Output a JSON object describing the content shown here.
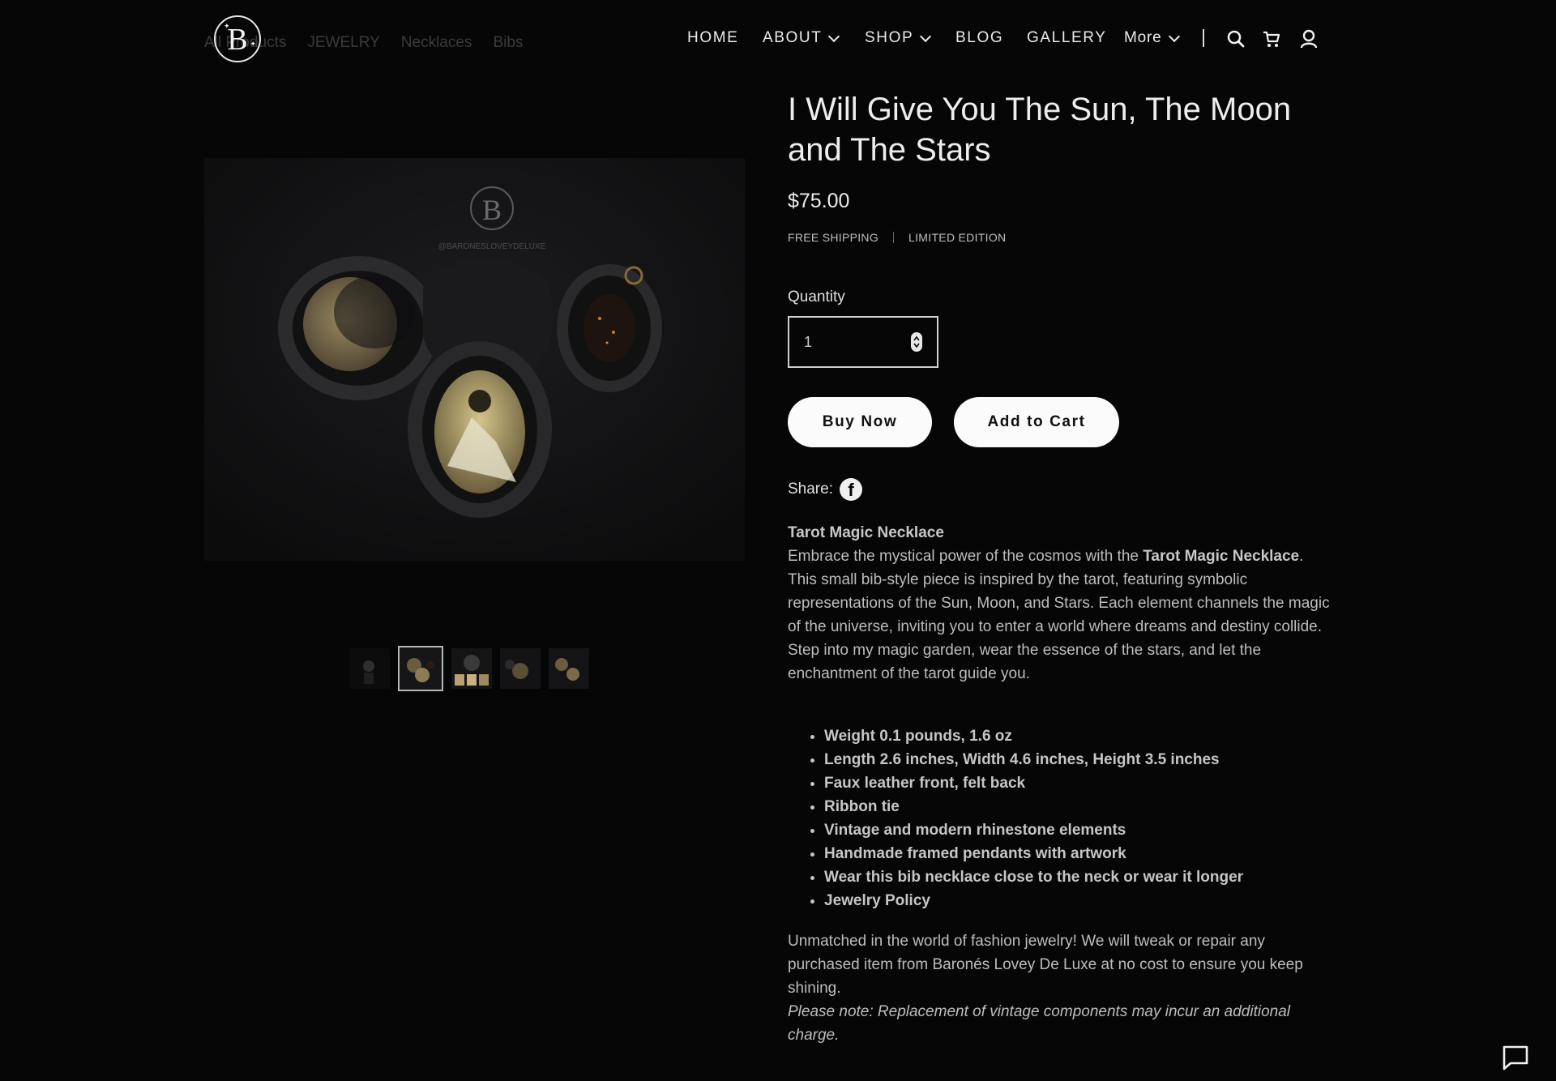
{
  "header": {
    "logo_letter": "B",
    "breadcrumbs": [
      "All Products",
      "JEWELRY",
      "Necklaces",
      "Bibs"
    ],
    "nav": [
      "HOME",
      "ABOUT",
      "SHOP",
      "BLOG",
      "GALLERY",
      "More"
    ]
  },
  "product": {
    "title": "I Will Give You The Sun, The Moon and The Stars",
    "price": "$75.00",
    "tags": [
      "FREE SHIPPING",
      "LIMITED EDITION"
    ],
    "image_watermark": "@BARONESLOVEYDELUXE",
    "quantity_label": "Quantity",
    "quantity_value": "1",
    "buy_now": "Buy Now",
    "add_to_cart": "Add to Cart",
    "share_label": "Share:"
  },
  "thumbnails": {
    "count": 5,
    "selected_index": 1
  },
  "description": {
    "heading": "Tarot Magic Necklace",
    "intro_before": "Embrace the mystical power of the cosmos with the ",
    "intro_bold": "Tarot Magic Necklace",
    "intro_after": ". This small bib-style piece is inspired by the tarot, featuring symbolic representations of the Sun, Moon, and Stars. Each element channels the magic of the universe, inviting you to enter a world where dreams and destiny collide. Step into my magic garden, wear the essence of the stars, and let the enchantment of the tarot guide you."
  },
  "specs": [
    "Weight 0.1 pounds, 1.6 oz",
    "Length 2.6 inches, Width 4.6 inches, Height 3.5 inches",
    "Faux leather front, felt back",
    "Ribbon tie",
    "Vintage and modern rhinestone elements",
    "Handmade framed pendants with artwork",
    "Wear this bib necklace close to the neck or wear it longer",
    "Jewelry Policy"
  ],
  "policy": {
    "text": "Unmatched in the world of fashion jewelry! We will tweak or repair any purchased item from Baronés Lovey De Luxe at no cost to ensure you keep shining.",
    "note": "Please note: Replacement of vintage components may incur an additional charge."
  },
  "colors": {
    "background": "#060607",
    "button": "#fbfbfb",
    "text": "#bdbdbd"
  },
  "icons": [
    "search-icon",
    "cart-icon",
    "account-icon",
    "facebook-icon",
    "chat-icon"
  ]
}
